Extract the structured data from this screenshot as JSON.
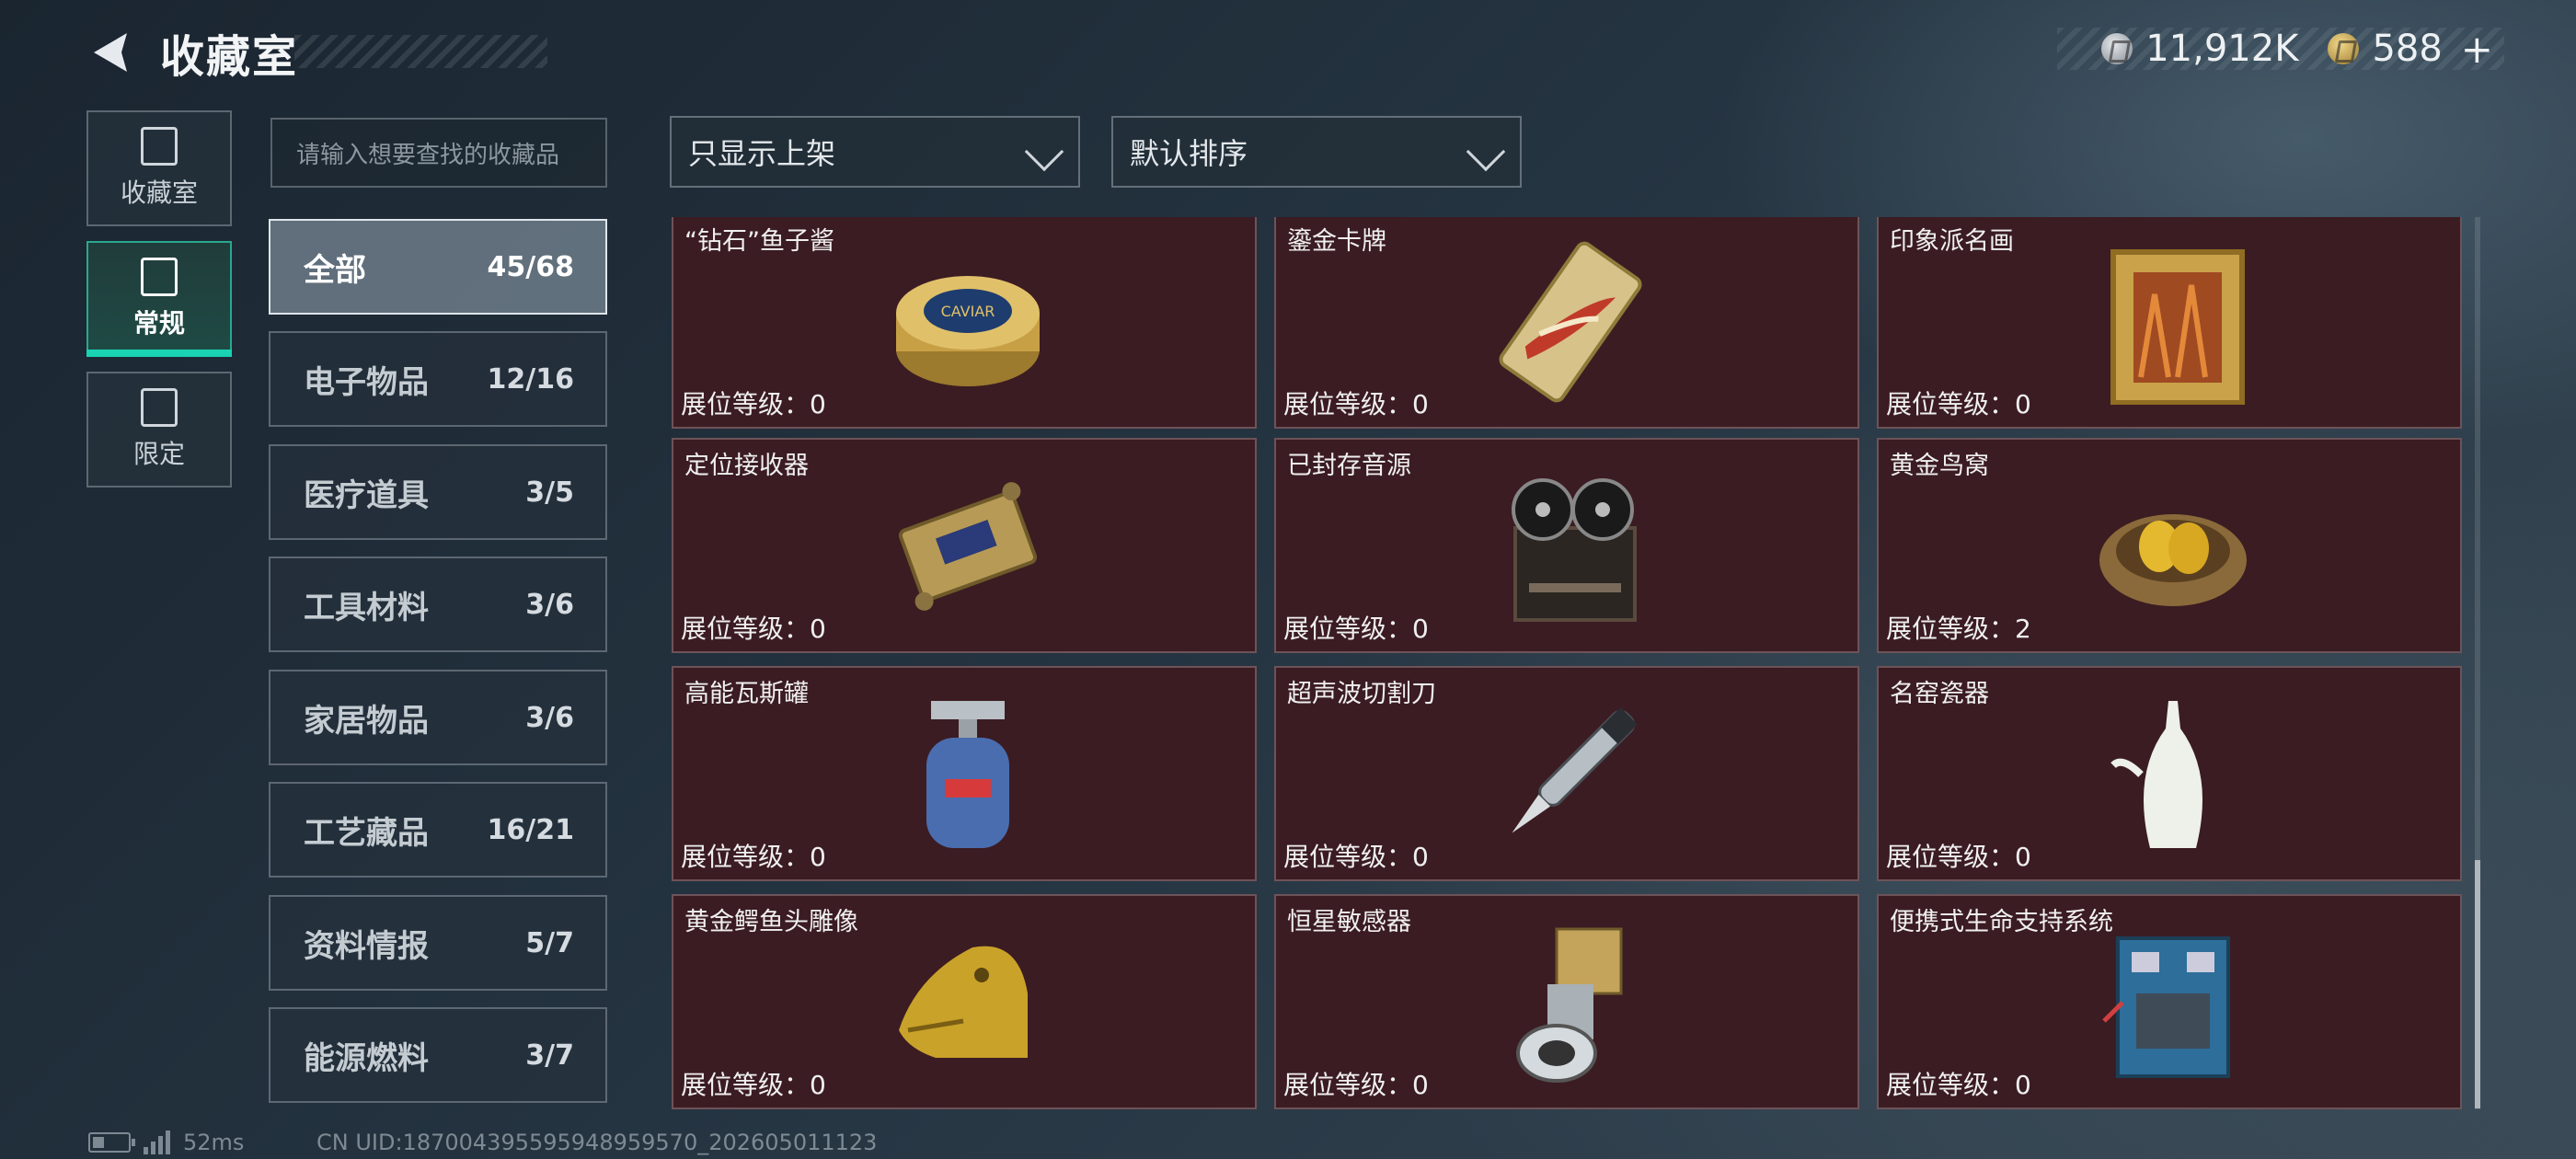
{
  "header": {
    "title": "收藏室",
    "currency_silver": "11,912K",
    "currency_gold": "588",
    "plus": "+"
  },
  "side_nav": [
    {
      "label": "收藏室",
      "icon": "vault-icon",
      "active": false
    },
    {
      "label": "常规",
      "icon": "regular-collection-icon",
      "active": true
    },
    {
      "label": "限定",
      "icon": "limited-collection-icon",
      "active": false
    }
  ],
  "search": {
    "placeholder": "请输入想要查找的收藏品"
  },
  "filters": {
    "shelf": "只显示上架",
    "sort": "默认排序"
  },
  "categories": [
    {
      "label": "全部",
      "count": "45/68",
      "active": true
    },
    {
      "label": "电子物品",
      "count": "12/16"
    },
    {
      "label": "医疗道具",
      "count": "3/5"
    },
    {
      "label": "工具材料",
      "count": "3/6"
    },
    {
      "label": "家居物品",
      "count": "3/6"
    },
    {
      "label": "工艺藏品",
      "count": "16/21"
    },
    {
      "label": "资料情报",
      "count": "5/7"
    },
    {
      "label": "能源燃料",
      "count": "3/7"
    }
  ],
  "items": [
    {
      "name": "“钻石”鱼子酱",
      "level": "展位等级：0",
      "icon": "caviar-tin-icon"
    },
    {
      "name": "鎏金卡牌",
      "level": "展位等级：0",
      "icon": "gilded-card-icon"
    },
    {
      "name": "印象派名画",
      "level": "展位等级：0",
      "icon": "framed-painting-icon"
    },
    {
      "name": "定位接收器",
      "level": "展位等级：0",
      "icon": "gps-receiver-icon"
    },
    {
      "name": "已封存音源",
      "level": "展位等级：0",
      "icon": "reel-tape-recorder-icon"
    },
    {
      "name": "黄金鸟窝",
      "level": "展位等级：2",
      "icon": "golden-nest-icon"
    },
    {
      "name": "高能瓦斯罐",
      "level": "展位等级：0",
      "icon": "gas-canister-icon"
    },
    {
      "name": "超声波切割刀",
      "level": "展位等级：0",
      "icon": "ultrasonic-cutter-icon"
    },
    {
      "name": "名窑瓷器",
      "level": "展位等级：0",
      "icon": "porcelain-vase-icon"
    },
    {
      "name": "黄金鳄鱼头雕像",
      "level": "展位等级：0",
      "icon": "golden-crocodile-head-icon"
    },
    {
      "name": "恒星敏感器",
      "level": "展位等级：0",
      "icon": "star-sensor-icon"
    },
    {
      "name": "便携式生命支持系统",
      "level": "展位等级：0",
      "icon": "life-support-system-icon"
    }
  ],
  "footer": {
    "ping": "52ms",
    "uid": "CN UID:1870043955959489595​70_202605011123"
  }
}
